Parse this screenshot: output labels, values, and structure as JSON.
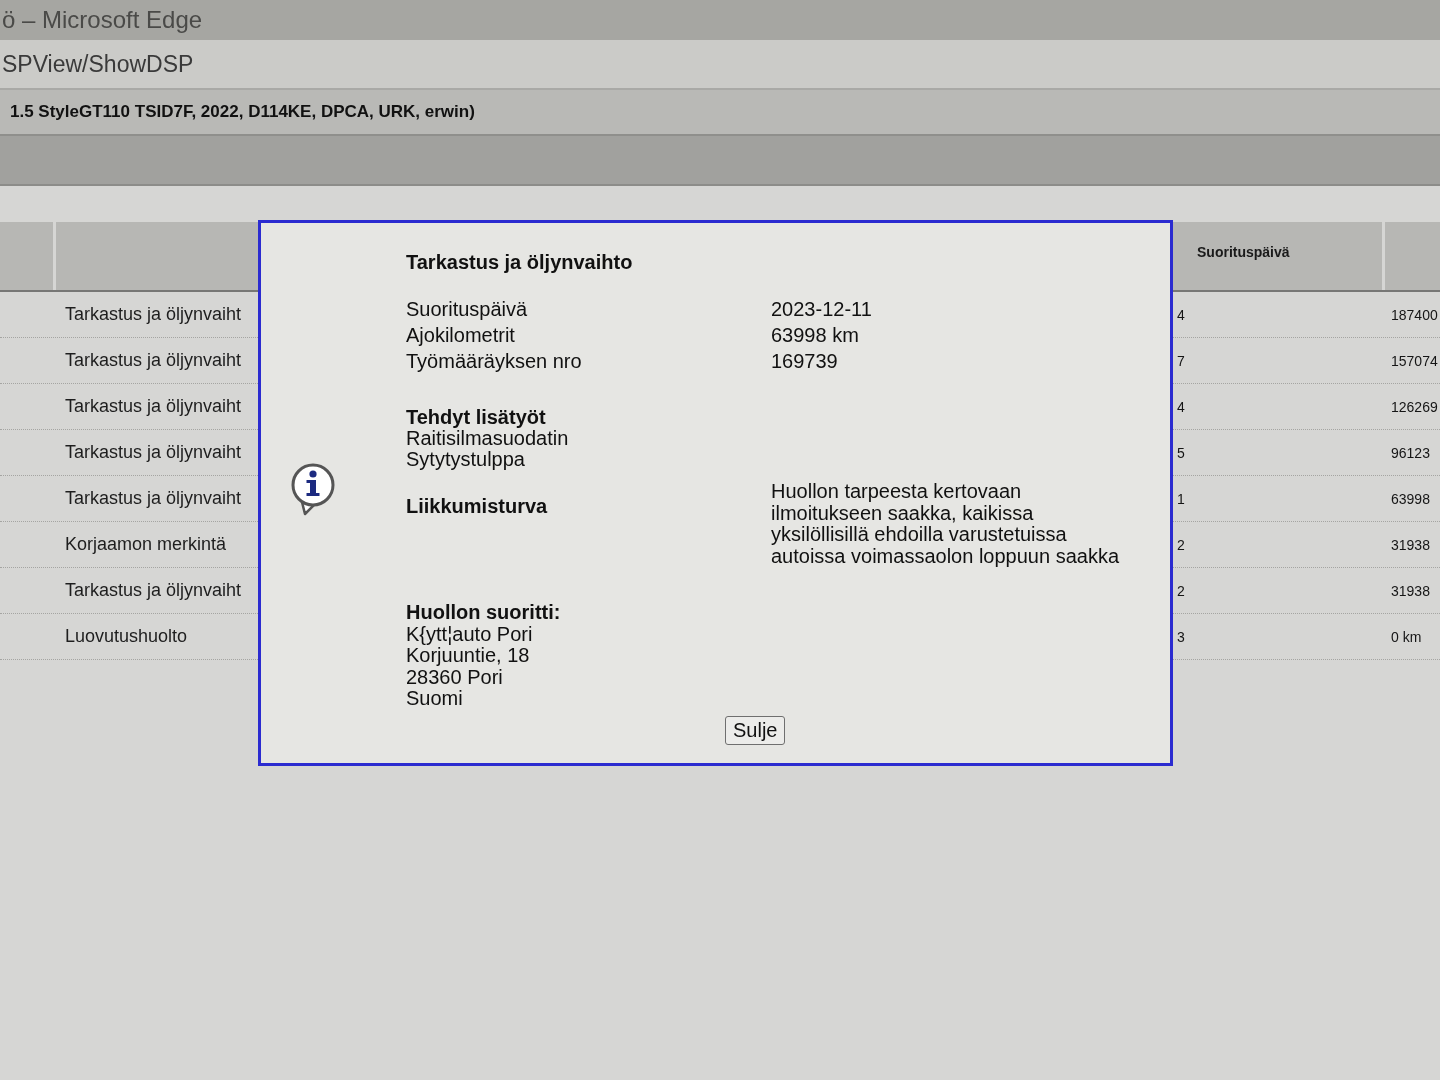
{
  "window": {
    "title": "ö – Microsoft Edge"
  },
  "address_bar": {
    "url": "SPView/ShowDSP"
  },
  "vehicle_header": "1.5 StyleGT110 TSID7F, 2022, D114KE, DPCA, URK, erwin)",
  "table": {
    "date_column_header": "Suorituspäivä",
    "rows": [
      {
        "column_2": "Tarkastus ja öljynvaiht",
        "suorituspaiva": "4",
        "column_4": "187400"
      },
      {
        "column_2": "Tarkastus ja öljynvaiht",
        "suorituspaiva": "7",
        "column_4": "157074"
      },
      {
        "column_2": "Tarkastus ja öljynvaiht",
        "suorituspaiva": "4",
        "column_4": "126269"
      },
      {
        "column_2": "Tarkastus ja öljynvaiht",
        "suorituspaiva": "5",
        "column_4": "96123"
      },
      {
        "column_2": "Tarkastus ja öljynvaiht",
        "suorituspaiva": "1",
        "column_4": "63998"
      },
      {
        "column_2": "Korjaamon merkintä",
        "suorituspaiva": "2",
        "column_4": "31938"
      },
      {
        "column_2": "Tarkastus ja öljynvaiht",
        "suorituspaiva": "2",
        "column_4": "31938"
      },
      {
        "column_2": "Luovutushuolto",
        "suorituspaiva": "3",
        "column_4": "0 km"
      }
    ]
  },
  "dialog": {
    "title": "Tarkastus ja öljynvaihto",
    "details": [
      {
        "label": "Suorituspäivä",
        "value": "2023-12-11"
      },
      {
        "label": "Ajokilometrit",
        "value": "63998 km"
      },
      {
        "label": "Työmääräyksen nro",
        "value": "169739"
      }
    ],
    "extra_work": {
      "heading": "Tehdyt lisätyöt",
      "items": [
        "Raitisilmasuodatin",
        "Sytytystulppa"
      ]
    },
    "mobility": {
      "label": "Liikkumisturva",
      "value": "Huollon tarpeesta kertovaan ilmoitukseen saakka, kaikissa yksilöllisillä ehdoilla varustetuissa autoissa voimassaolon loppuun saakka"
    },
    "performed_by": {
      "heading": "Huollon suoritti:",
      "lines": [
        "K{ytt¦auto Pori",
        "Korjuuntie, 18",
        "28360 Pori",
        "Suomi"
      ]
    },
    "buttons": [
      "Sulje"
    ]
  }
}
